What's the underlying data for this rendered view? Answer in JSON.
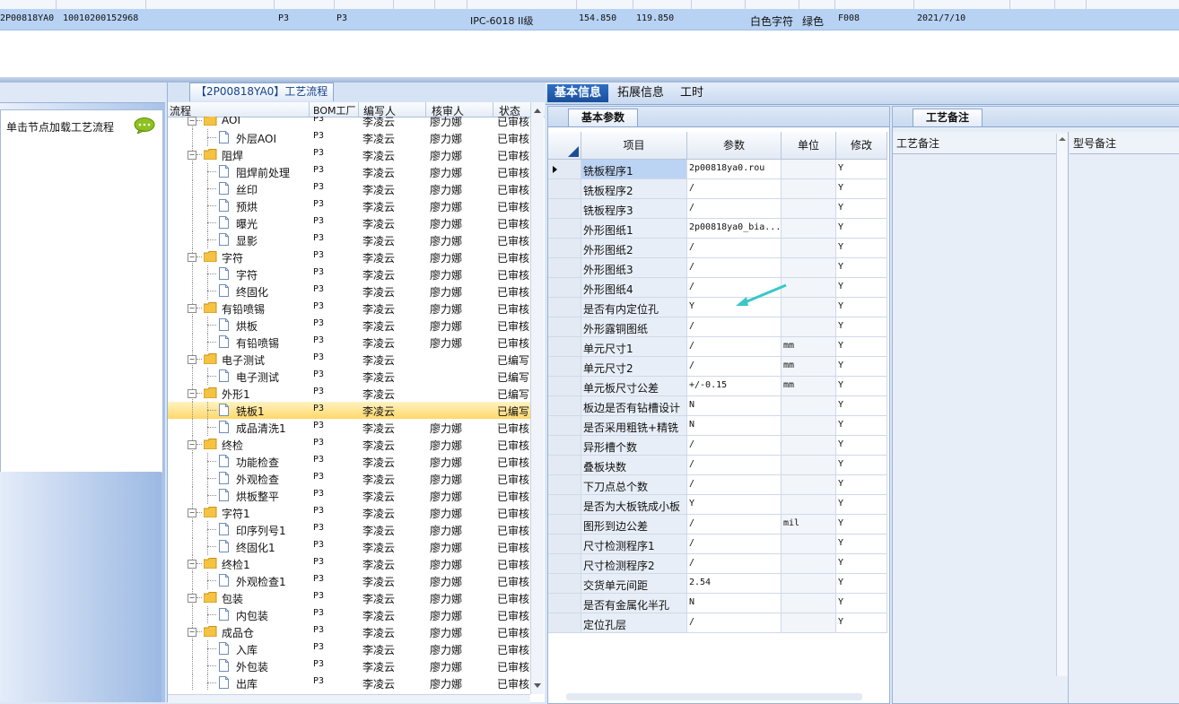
{
  "top_grid": {
    "row": {
      "code": "2P00818YA0",
      "number": "10010200152968",
      "v1": "P3",
      "v2": "P3",
      "standard": "IPC-6018 II级",
      "length": "154.850",
      "width": "119.850",
      "char_color": "白色字符",
      "mask_color": "绿色",
      "code2": "F008",
      "date": "2021/7/10"
    }
  },
  "left_panel": {
    "hint": "单击节点加载工艺流程"
  },
  "tree_panel": {
    "tab": "【2P00818YA0】工艺流程",
    "headers": {
      "flow": "流程",
      "bom": "BOM工厂",
      "writer": "编写人",
      "reviewer": "核审人",
      "status": "状态"
    },
    "rows": [
      {
        "name": "AOI",
        "level": 0,
        "bom": "P3",
        "writer": "李凌云",
        "reviewer": "廖力娜",
        "status": "已审核"
      },
      {
        "name": "外层AOI",
        "level": 1,
        "bom": "P3",
        "writer": "李凌云",
        "reviewer": "廖力娜",
        "status": "已审核"
      },
      {
        "name": "阻焊",
        "level": 0,
        "bom": "P3",
        "writer": "李凌云",
        "reviewer": "廖力娜",
        "status": "已审核"
      },
      {
        "name": "阻焊前处理",
        "level": 1,
        "bom": "P3",
        "writer": "李凌云",
        "reviewer": "廖力娜",
        "status": "已审核"
      },
      {
        "name": "丝印",
        "level": 1,
        "bom": "P3",
        "writer": "李凌云",
        "reviewer": "廖力娜",
        "status": "已审核"
      },
      {
        "name": "预烘",
        "level": 1,
        "bom": "P3",
        "writer": "李凌云",
        "reviewer": "廖力娜",
        "status": "已审核"
      },
      {
        "name": "曝光",
        "level": 1,
        "bom": "P3",
        "writer": "李凌云",
        "reviewer": "廖力娜",
        "status": "已审核"
      },
      {
        "name": "显影",
        "level": 1,
        "bom": "P3",
        "writer": "李凌云",
        "reviewer": "廖力娜",
        "status": "已审核"
      },
      {
        "name": "字符",
        "level": 0,
        "bom": "P3",
        "writer": "李凌云",
        "reviewer": "廖力娜",
        "status": "已审核"
      },
      {
        "name": "字符",
        "level": 1,
        "bom": "P3",
        "writer": "李凌云",
        "reviewer": "廖力娜",
        "status": "已审核"
      },
      {
        "name": "终固化",
        "level": 1,
        "bom": "P3",
        "writer": "李凌云",
        "reviewer": "廖力娜",
        "status": "已审核"
      },
      {
        "name": "有铅喷锡",
        "level": 0,
        "bom": "P3",
        "writer": "李凌云",
        "reviewer": "廖力娜",
        "status": "已审核"
      },
      {
        "name": "烘板",
        "level": 1,
        "bom": "P3",
        "writer": "李凌云",
        "reviewer": "廖力娜",
        "status": "已审核"
      },
      {
        "name": "有铅喷锡",
        "level": 1,
        "bom": "P3",
        "writer": "李凌云",
        "reviewer": "廖力娜",
        "status": "已审核"
      },
      {
        "name": "电子测试",
        "level": 0,
        "bom": "P3",
        "writer": "李凌云",
        "reviewer": "",
        "status": "已编写"
      },
      {
        "name": "电子测试",
        "level": 1,
        "bom": "P3",
        "writer": "李凌云",
        "reviewer": "",
        "status": "已编写"
      },
      {
        "name": "外形1",
        "level": 0,
        "bom": "P3",
        "writer": "李凌云",
        "reviewer": "",
        "status": "已编写"
      },
      {
        "name": "铣板1",
        "level": 1,
        "bom": "P3",
        "writer": "李凌云",
        "reviewer": "",
        "status": "已编写",
        "selected": true
      },
      {
        "name": "成品清洗1",
        "level": 1,
        "bom": "P3",
        "writer": "李凌云",
        "reviewer": "廖力娜",
        "status": "已审核"
      },
      {
        "name": "终检",
        "level": 0,
        "bom": "P3",
        "writer": "李凌云",
        "reviewer": "廖力娜",
        "status": "已审核"
      },
      {
        "name": "功能检查",
        "level": 1,
        "bom": "P3",
        "writer": "李凌云",
        "reviewer": "廖力娜",
        "status": "已审核"
      },
      {
        "name": "外观检查",
        "level": 1,
        "bom": "P3",
        "writer": "李凌云",
        "reviewer": "廖力娜",
        "status": "已审核"
      },
      {
        "name": "烘板整平",
        "level": 1,
        "bom": "P3",
        "writer": "李凌云",
        "reviewer": "廖力娜",
        "status": "已审核"
      },
      {
        "name": "字符1",
        "level": 0,
        "bom": "P3",
        "writer": "李凌云",
        "reviewer": "廖力娜",
        "status": "已审核"
      },
      {
        "name": "印序列号1",
        "level": 1,
        "bom": "P3",
        "writer": "李凌云",
        "reviewer": "廖力娜",
        "status": "已审核"
      },
      {
        "name": "终固化1",
        "level": 1,
        "bom": "P3",
        "writer": "李凌云",
        "reviewer": "廖力娜",
        "status": "已审核"
      },
      {
        "name": "终检1",
        "level": 0,
        "bom": "P3",
        "writer": "李凌云",
        "reviewer": "廖力娜",
        "status": "已审核"
      },
      {
        "name": "外观检查1",
        "level": 1,
        "bom": "P3",
        "writer": "李凌云",
        "reviewer": "廖力娜",
        "status": "已审核"
      },
      {
        "name": "包装",
        "level": 0,
        "bom": "P3",
        "writer": "李凌云",
        "reviewer": "廖力娜",
        "status": "已审核"
      },
      {
        "name": "内包装",
        "level": 1,
        "bom": "P3",
        "writer": "李凌云",
        "reviewer": "廖力娜",
        "status": "已审核"
      },
      {
        "name": "成品仓",
        "level": 0,
        "bom": "P3",
        "writer": "李凌云",
        "reviewer": "廖力娜",
        "status": "已审核"
      },
      {
        "name": "入库",
        "level": 1,
        "bom": "P3",
        "writer": "李凌云",
        "reviewer": "廖力娜",
        "status": "已审核"
      },
      {
        "name": "外包装",
        "level": 1,
        "bom": "P3",
        "writer": "李凌云",
        "reviewer": "廖力娜",
        "status": "已审核"
      },
      {
        "name": "出库",
        "level": 1,
        "bom": "P3",
        "writer": "李凌云",
        "reviewer": "廖力娜",
        "status": "已审核"
      }
    ]
  },
  "right_tabs": {
    "basic": "基本信息",
    "extended": "拓展信息",
    "hours": "工时"
  },
  "basic_panel": {
    "tab": "基本参数",
    "headers": {
      "item": "项目",
      "param": "参数",
      "unit": "单位",
      "modify": "修改"
    },
    "rows": [
      {
        "item": "铣板程序1",
        "param": "2p00818ya0.rou",
        "unit": "",
        "modify": "Y",
        "current": true
      },
      {
        "item": "铣板程序2",
        "param": "/",
        "unit": "",
        "modify": "Y"
      },
      {
        "item": "铣板程序3",
        "param": "/",
        "unit": "",
        "modify": "Y"
      },
      {
        "item": "外形图纸1",
        "param": "2p00818ya0_bia...",
        "unit": "",
        "modify": "Y"
      },
      {
        "item": "外形图纸2",
        "param": "/",
        "unit": "",
        "modify": "Y"
      },
      {
        "item": "外形图纸3",
        "param": "/",
        "unit": "",
        "modify": "Y"
      },
      {
        "item": "外形图纸4",
        "param": "/",
        "unit": "",
        "modify": "Y"
      },
      {
        "item": "是否有内定位孔",
        "param": "Y",
        "unit": "",
        "modify": "Y"
      },
      {
        "item": "外形露铜图纸",
        "param": "/",
        "unit": "",
        "modify": "Y"
      },
      {
        "item": "单元尺寸1",
        "param": "/",
        "unit": "mm",
        "modify": "Y"
      },
      {
        "item": "单元尺寸2",
        "param": "/",
        "unit": "mm",
        "modify": "Y"
      },
      {
        "item": "单元板尺寸公差",
        "param": "+/-0.15",
        "unit": "mm",
        "modify": "Y"
      },
      {
        "item": "板边是否有钻槽设计",
        "param": "N",
        "unit": "",
        "modify": "Y"
      },
      {
        "item": "是否采用粗铣+精铣",
        "param": "N",
        "unit": "",
        "modify": "Y"
      },
      {
        "item": "异形槽个数",
        "param": "/",
        "unit": "",
        "modify": "Y"
      },
      {
        "item": "叠板块数",
        "param": "/",
        "unit": "",
        "modify": "Y"
      },
      {
        "item": "下刀点总个数",
        "param": "/",
        "unit": "",
        "modify": "Y"
      },
      {
        "item": "是否为大板铣成小板",
        "param": "Y",
        "unit": "",
        "modify": "Y"
      },
      {
        "item": "图形到边公差",
        "param": "/",
        "unit": "mil",
        "modify": "Y"
      },
      {
        "item": "尺寸检测程序1",
        "param": "/",
        "unit": "",
        "modify": "Y"
      },
      {
        "item": "尺寸检测程序2",
        "param": "/",
        "unit": "",
        "modify": "Y"
      },
      {
        "item": "交货单元间距",
        "param": "2.54",
        "unit": "",
        "modify": "Y"
      },
      {
        "item": "是否有金属化半孔",
        "param": "N",
        "unit": "",
        "modify": "Y"
      },
      {
        "item": "定位孔层",
        "param": "/",
        "unit": "",
        "modify": "Y"
      }
    ]
  },
  "remark_panel": {
    "tab": "工艺备注",
    "craft_note": "工艺备注",
    "model_note": "型号备注"
  },
  "colors": {
    "accent": "#1b4f9c",
    "selection": "#ffd86a",
    "row_highlight": "#b7d2f3"
  }
}
